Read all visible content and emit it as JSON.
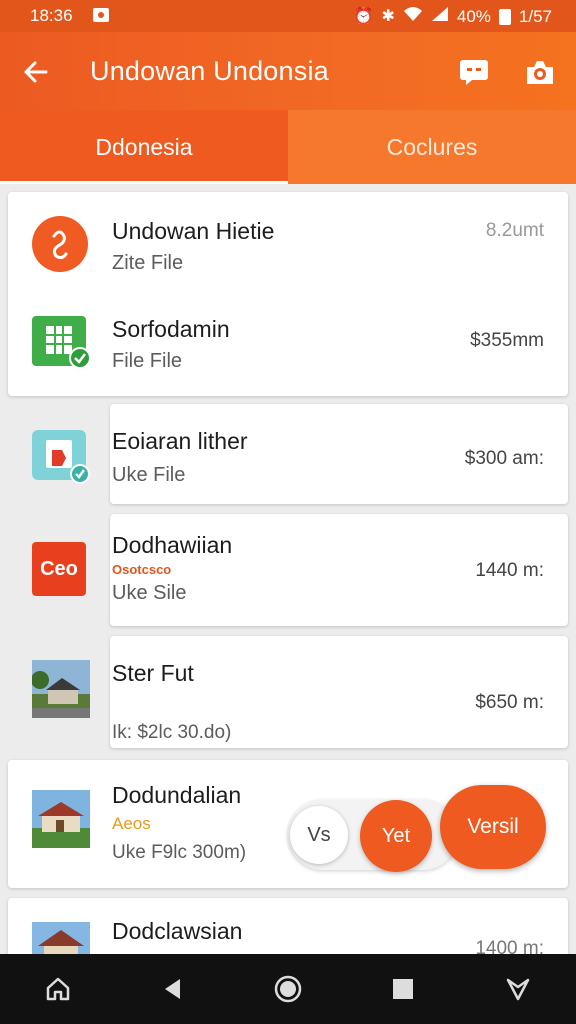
{
  "status_bar": {
    "time": "18:36",
    "battery": "40%",
    "clock_right": "1/57"
  },
  "app_bar": {
    "title": "Undowan Undonsia"
  },
  "tabs": [
    {
      "label": "Ddonesia",
      "active": true
    },
    {
      "label": "Coclures",
      "active": false
    }
  ],
  "items": [
    {
      "title": "Undowan Hietie",
      "subtitle": "Zite File",
      "meta": "8.2umt",
      "icon": "circle-logo-icon"
    },
    {
      "title": "Sorfodamin",
      "subtitle": "File File",
      "meta": "$355mm",
      "icon": "spreadsheet-icon"
    },
    {
      "title": "Eoiaran lither",
      "subtitle": "Uke File",
      "meta": "$300 am:",
      "icon": "document-check-icon"
    },
    {
      "title": "Dodhawiian",
      "sublabel": "Osotcsco",
      "subtitle": "Uke Sile",
      "meta": "1440 m:",
      "icon": "ceo-app-icon",
      "icon_text": "Ceo"
    },
    {
      "title": "Ster Fut",
      "subtitle": "Ik: $2lc 30.do)",
      "meta": "$650 m:",
      "icon": "house-photo-icon"
    },
    {
      "title": "Dodundalian",
      "sublabel": "Aeos",
      "subtitle": "Uke F9lc 300m)",
      "icon": "building-photo-icon"
    },
    {
      "title": "Dodclawsian",
      "meta": "1400 m:",
      "icon": "temple-photo-icon"
    }
  ],
  "actions": {
    "vs_label": "Vs",
    "yet_label": "Yet",
    "versil_label": "Versil"
  },
  "colors": {
    "accent": "#ee5a1f",
    "status_bar": "#e2561c",
    "nav_bar": "#111111"
  }
}
